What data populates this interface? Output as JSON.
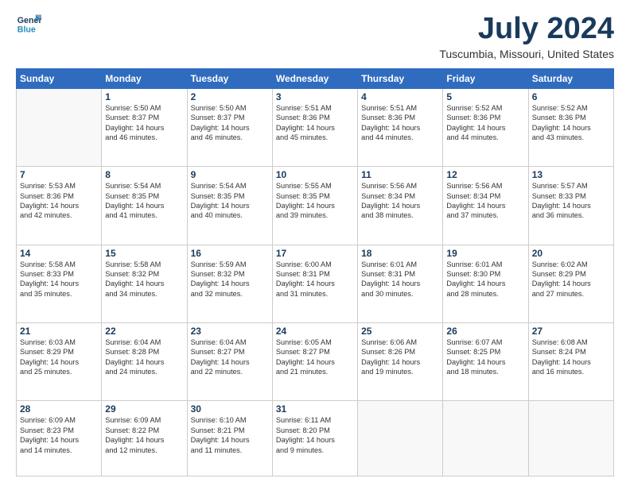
{
  "logo": {
    "line1": "General",
    "line2": "Blue"
  },
  "title": "July 2024",
  "subtitle": "Tuscumbia, Missouri, United States",
  "days_of_week": [
    "Sunday",
    "Monday",
    "Tuesday",
    "Wednesday",
    "Thursday",
    "Friday",
    "Saturday"
  ],
  "weeks": [
    [
      {
        "num": "",
        "info": ""
      },
      {
        "num": "1",
        "info": "Sunrise: 5:50 AM\nSunset: 8:37 PM\nDaylight: 14 hours\nand 46 minutes."
      },
      {
        "num": "2",
        "info": "Sunrise: 5:50 AM\nSunset: 8:37 PM\nDaylight: 14 hours\nand 46 minutes."
      },
      {
        "num": "3",
        "info": "Sunrise: 5:51 AM\nSunset: 8:36 PM\nDaylight: 14 hours\nand 45 minutes."
      },
      {
        "num": "4",
        "info": "Sunrise: 5:51 AM\nSunset: 8:36 PM\nDaylight: 14 hours\nand 44 minutes."
      },
      {
        "num": "5",
        "info": "Sunrise: 5:52 AM\nSunset: 8:36 PM\nDaylight: 14 hours\nand 44 minutes."
      },
      {
        "num": "6",
        "info": "Sunrise: 5:52 AM\nSunset: 8:36 PM\nDaylight: 14 hours\nand 43 minutes."
      }
    ],
    [
      {
        "num": "7",
        "info": "Sunrise: 5:53 AM\nSunset: 8:36 PM\nDaylight: 14 hours\nand 42 minutes."
      },
      {
        "num": "8",
        "info": "Sunrise: 5:54 AM\nSunset: 8:35 PM\nDaylight: 14 hours\nand 41 minutes."
      },
      {
        "num": "9",
        "info": "Sunrise: 5:54 AM\nSunset: 8:35 PM\nDaylight: 14 hours\nand 40 minutes."
      },
      {
        "num": "10",
        "info": "Sunrise: 5:55 AM\nSunset: 8:35 PM\nDaylight: 14 hours\nand 39 minutes."
      },
      {
        "num": "11",
        "info": "Sunrise: 5:56 AM\nSunset: 8:34 PM\nDaylight: 14 hours\nand 38 minutes."
      },
      {
        "num": "12",
        "info": "Sunrise: 5:56 AM\nSunset: 8:34 PM\nDaylight: 14 hours\nand 37 minutes."
      },
      {
        "num": "13",
        "info": "Sunrise: 5:57 AM\nSunset: 8:33 PM\nDaylight: 14 hours\nand 36 minutes."
      }
    ],
    [
      {
        "num": "14",
        "info": "Sunrise: 5:58 AM\nSunset: 8:33 PM\nDaylight: 14 hours\nand 35 minutes."
      },
      {
        "num": "15",
        "info": "Sunrise: 5:58 AM\nSunset: 8:32 PM\nDaylight: 14 hours\nand 34 minutes."
      },
      {
        "num": "16",
        "info": "Sunrise: 5:59 AM\nSunset: 8:32 PM\nDaylight: 14 hours\nand 32 minutes."
      },
      {
        "num": "17",
        "info": "Sunrise: 6:00 AM\nSunset: 8:31 PM\nDaylight: 14 hours\nand 31 minutes."
      },
      {
        "num": "18",
        "info": "Sunrise: 6:01 AM\nSunset: 8:31 PM\nDaylight: 14 hours\nand 30 minutes."
      },
      {
        "num": "19",
        "info": "Sunrise: 6:01 AM\nSunset: 8:30 PM\nDaylight: 14 hours\nand 28 minutes."
      },
      {
        "num": "20",
        "info": "Sunrise: 6:02 AM\nSunset: 8:29 PM\nDaylight: 14 hours\nand 27 minutes."
      }
    ],
    [
      {
        "num": "21",
        "info": "Sunrise: 6:03 AM\nSunset: 8:29 PM\nDaylight: 14 hours\nand 25 minutes."
      },
      {
        "num": "22",
        "info": "Sunrise: 6:04 AM\nSunset: 8:28 PM\nDaylight: 14 hours\nand 24 minutes."
      },
      {
        "num": "23",
        "info": "Sunrise: 6:04 AM\nSunset: 8:27 PM\nDaylight: 14 hours\nand 22 minutes."
      },
      {
        "num": "24",
        "info": "Sunrise: 6:05 AM\nSunset: 8:27 PM\nDaylight: 14 hours\nand 21 minutes."
      },
      {
        "num": "25",
        "info": "Sunrise: 6:06 AM\nSunset: 8:26 PM\nDaylight: 14 hours\nand 19 minutes."
      },
      {
        "num": "26",
        "info": "Sunrise: 6:07 AM\nSunset: 8:25 PM\nDaylight: 14 hours\nand 18 minutes."
      },
      {
        "num": "27",
        "info": "Sunrise: 6:08 AM\nSunset: 8:24 PM\nDaylight: 14 hours\nand 16 minutes."
      }
    ],
    [
      {
        "num": "28",
        "info": "Sunrise: 6:09 AM\nSunset: 8:23 PM\nDaylight: 14 hours\nand 14 minutes."
      },
      {
        "num": "29",
        "info": "Sunrise: 6:09 AM\nSunset: 8:22 PM\nDaylight: 14 hours\nand 12 minutes."
      },
      {
        "num": "30",
        "info": "Sunrise: 6:10 AM\nSunset: 8:21 PM\nDaylight: 14 hours\nand 11 minutes."
      },
      {
        "num": "31",
        "info": "Sunrise: 6:11 AM\nSunset: 8:20 PM\nDaylight: 14 hours\nand 9 minutes."
      },
      {
        "num": "",
        "info": ""
      },
      {
        "num": "",
        "info": ""
      },
      {
        "num": "",
        "info": ""
      }
    ]
  ]
}
